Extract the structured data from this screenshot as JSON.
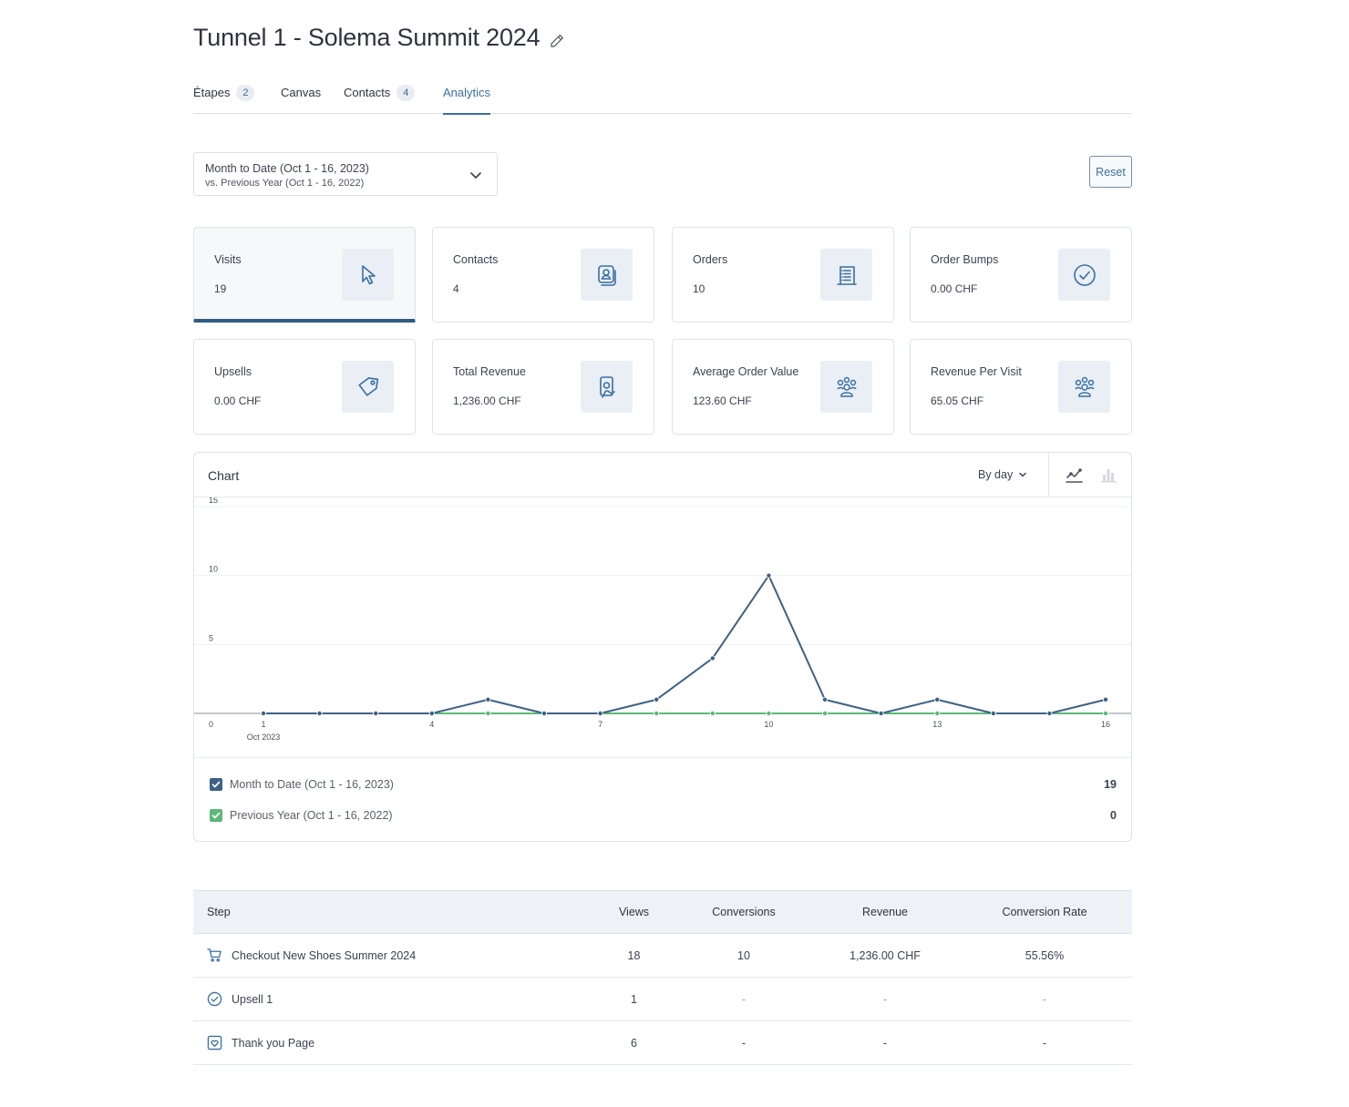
{
  "header": {
    "title": "Tunnel 1 - Solema Summit 2024",
    "edit_icon": "pencil-icon"
  },
  "tabs": [
    {
      "label": "Étapes",
      "badge": "2"
    },
    {
      "label": "Canvas"
    },
    {
      "label": "Contacts",
      "badge": "4"
    },
    {
      "label": "Analytics",
      "active": true
    }
  ],
  "filters": {
    "date_range": "Month to Date (Oct 1 - 16, 2023)",
    "comparison": "vs. Previous Year (Oct 1 - 16, 2022)",
    "reset_label": "Reset"
  },
  "metrics": [
    {
      "label": "Visits",
      "value": "19",
      "icon": "cursor-icon",
      "active": true
    },
    {
      "label": "Contacts",
      "value": "4",
      "icon": "contact-card-icon"
    },
    {
      "label": "Orders",
      "value": "10",
      "icon": "receipt-icon"
    },
    {
      "label": "Order Bumps",
      "value": "0.00 CHF",
      "icon": "check-circle-icon"
    },
    {
      "label": "Upsells",
      "value": "0.00 CHF",
      "icon": "tag-icon"
    },
    {
      "label": "Total Revenue",
      "value": "1,236.00 CHF",
      "icon": "money-hand-icon"
    },
    {
      "label": "Average Order Value",
      "value": "123.60 CHF",
      "icon": "group-icon"
    },
    {
      "label": "Revenue Per Visit",
      "value": "65.05 CHF",
      "icon": "group-icon"
    }
  ],
  "chart_panel": {
    "title": "Chart",
    "interval_label": "By day"
  },
  "chart_data": {
    "type": "line",
    "x": [
      1,
      2,
      3,
      4,
      5,
      6,
      7,
      8,
      9,
      10,
      11,
      12,
      13,
      14,
      15,
      16
    ],
    "x_tick_labels": [
      "1",
      "4",
      "7",
      "10",
      "13",
      "16"
    ],
    "x_sublabel": "Oct 2023",
    "y_ticks": [
      "0",
      "5",
      "10",
      "15"
    ],
    "ylim": [
      0,
      15
    ],
    "series": [
      {
        "name": "Month to Date (Oct 1 - 16, 2023)",
        "color": "#3d6185",
        "values": [
          0,
          0,
          0,
          0,
          1,
          0,
          0,
          1,
          4,
          10,
          1,
          0,
          1,
          0,
          0,
          1
        ],
        "total": "19"
      },
      {
        "name": "Previous Year (Oct 1 - 16, 2022)",
        "color": "#5cb878",
        "values": [
          0,
          0,
          0,
          0,
          0,
          0,
          0,
          0,
          0,
          0,
          0,
          0,
          0,
          0,
          0,
          0
        ],
        "total": "0"
      }
    ]
  },
  "table": {
    "headers": {
      "step": "Step",
      "views": "Views",
      "conversions": "Conversions",
      "revenue": "Revenue",
      "rate": "Conversion Rate"
    },
    "rows": [
      {
        "icon": "cart-icon",
        "step": "Checkout New Shoes Summer 2024",
        "views": "18",
        "conversions": "10",
        "revenue": "1,236.00 CHF",
        "rate": "55.56%"
      },
      {
        "icon": "check-circle-icon",
        "step": "Upsell 1",
        "views": "1",
        "conversions": "-",
        "revenue": "-",
        "rate": "-"
      },
      {
        "icon": "heart-box-icon",
        "step": "Thank you Page",
        "views": "6",
        "conversions": "-",
        "revenue": "-",
        "rate": "-"
      }
    ]
  }
}
